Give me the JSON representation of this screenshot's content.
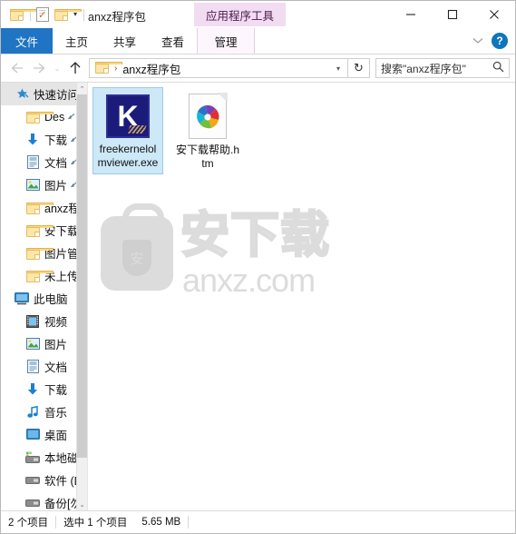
{
  "titlebar": {
    "window_title": "anxz程序包",
    "contextual_tab_title": "应用程序工具",
    "quick_access": [
      {
        "name": "folder-icon",
        "label": ""
      },
      {
        "name": "properties-icon",
        "label": ""
      },
      {
        "name": "new-folder-icon",
        "label": ""
      }
    ],
    "caret": "▾",
    "minimize": "—",
    "maximize": "▢",
    "close": "✕"
  },
  "ribbon": {
    "tabs": [
      {
        "label": "文件",
        "type": "file"
      },
      {
        "label": "主页",
        "type": "normal"
      },
      {
        "label": "共享",
        "type": "normal"
      },
      {
        "label": "查看",
        "type": "normal"
      },
      {
        "label": "管理",
        "type": "contextual"
      }
    ],
    "collapse_caret": "⌄",
    "help_label": "?"
  },
  "addressbar": {
    "back": "←",
    "forward": "→",
    "history": "⌄",
    "up": "↑",
    "breadcrumb_separator": "›",
    "breadcrumb_text": "anxz程序包",
    "breadcrumb_caret": "▾",
    "refresh": "↻",
    "search_placeholder": "搜索\"anxz程序包\""
  },
  "navpane": {
    "items": [
      {
        "label": "快速访问",
        "icon": "star-pin-icon",
        "level": "root",
        "selected": true,
        "pinned": false
      },
      {
        "label": "Des",
        "icon": "folder-icon",
        "level": "child",
        "selected": false,
        "pinned": true
      },
      {
        "label": "下载",
        "icon": "download-arrow-icon",
        "level": "child",
        "selected": false,
        "pinned": true
      },
      {
        "label": "文档",
        "icon": "documents-icon",
        "level": "child",
        "selected": false,
        "pinned": true
      },
      {
        "label": "图片",
        "icon": "pictures-icon",
        "level": "child",
        "selected": false,
        "pinned": true
      },
      {
        "label": "anxz程",
        "icon": "folder-icon",
        "level": "child",
        "selected": false,
        "pinned": false
      },
      {
        "label": "安下载",
        "icon": "folder-icon",
        "level": "child",
        "selected": false,
        "pinned": false
      },
      {
        "label": "图片管",
        "icon": "folder-icon",
        "level": "child",
        "selected": false,
        "pinned": false
      },
      {
        "label": "未上传",
        "icon": "folder-icon",
        "level": "child",
        "selected": false,
        "pinned": false
      },
      {
        "label": "此电脑",
        "icon": "this-pc-icon",
        "level": "root",
        "selected": false,
        "pinned": false
      },
      {
        "label": "视频",
        "icon": "videos-icon",
        "level": "child",
        "selected": false,
        "pinned": false
      },
      {
        "label": "图片",
        "icon": "pictures-icon",
        "level": "child",
        "selected": false,
        "pinned": false
      },
      {
        "label": "文档",
        "icon": "documents-icon",
        "level": "child",
        "selected": false,
        "pinned": false
      },
      {
        "label": "下载",
        "icon": "download-arrow-icon",
        "level": "child",
        "selected": false,
        "pinned": false
      },
      {
        "label": "音乐",
        "icon": "music-note-icon",
        "level": "child",
        "selected": false,
        "pinned": false
      },
      {
        "label": "桌面",
        "icon": "desktop-icon",
        "level": "child",
        "selected": false,
        "pinned": false
      },
      {
        "label": "本地磁",
        "icon": "local-disk-icon",
        "level": "child",
        "selected": false,
        "pinned": false
      },
      {
        "label": "软件 (D",
        "icon": "drive-icon",
        "level": "child",
        "selected": false,
        "pinned": false
      },
      {
        "label": "备份[勿",
        "icon": "drive-icon",
        "level": "child",
        "selected": false,
        "pinned": false
      }
    ],
    "scroll_up": "⌃",
    "scroll_down": "⌄"
  },
  "files": {
    "items": [
      {
        "name": "freekernelolmviewer.exe",
        "icon": "kernel-app-icon",
        "selected": true
      },
      {
        "name": "安下载帮助.htm",
        "icon": "html-pinwheel-icon",
        "selected": false
      }
    ]
  },
  "watermark": {
    "bag_text": "安",
    "cn_text": "安下载",
    "en_text": "anxz.com"
  },
  "status": {
    "item_count": "2 个项目",
    "selection": "选中 1 个项目",
    "size": "5.65 MB"
  },
  "colors": {
    "accent": "#1f74c4",
    "contextual_tab": "#f2dcf2",
    "selection": "#cde8f7",
    "selection_border": "#9ccbe8",
    "nav_selected": "#e5e5e5",
    "watermark": "#dcdcdc"
  }
}
